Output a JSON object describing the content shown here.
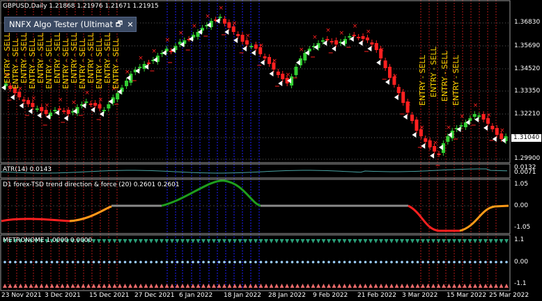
{
  "window": {
    "symbol_title": "GBPUSD,Daily  1.21868 1.21976 1.21671 1.21915",
    "tester_panel_title": "NNFX Algo Tester (Ultimat",
    "restore_icon": "restore-window-icon",
    "close_icon": "close-icon",
    "restore_glyph": "🗗",
    "close_glyph": "✕"
  },
  "main_chart": {
    "price_labels": [
      "1.36830",
      "1.35690",
      "1.34520",
      "1.33350",
      "1.32210",
      "1.31040",
      "1.29900"
    ],
    "current_price": "1.31040",
    "entry_sell_label": "ENTRY - SELL",
    "entry_sell_count": 18
  },
  "date_axis": {
    "labels": [
      "23 Nov 2021",
      "3 Dec 2021",
      "15 Dec 2021",
      "27 Dec 2021",
      "6 Jan 2022",
      "18 Jan 2022",
      "28 Jan 2022",
      "9 Feb 2022",
      "21 Feb 2022",
      "3 Mar 2022",
      "15 Mar 2022",
      "25 Mar 2022"
    ]
  },
  "atr_panel": {
    "title": "ATR(14) 0.0143",
    "scale_labels": [
      "0.0132",
      "0.0071"
    ]
  },
  "tsd_panel": {
    "title": "D1 forex-TSD trend direction & force (20) 0.2601 0.2601",
    "scale_labels": [
      "1.05",
      "0.00",
      "-1.05"
    ]
  },
  "metronome_panel": {
    "title": "METRONOME 1.0000 0.0000",
    "scale_labels": [
      "1.1",
      "0.00",
      "-1.1"
    ]
  },
  "colors": {
    "bull": "#32cd32",
    "bear": "#ff2020",
    "grid": "#5a5a5a",
    "sell_text": "#ffd700",
    "blue_line": "#1e1eff",
    "red_line": "#b01818",
    "tester_bg": "#3b4a63"
  }
}
